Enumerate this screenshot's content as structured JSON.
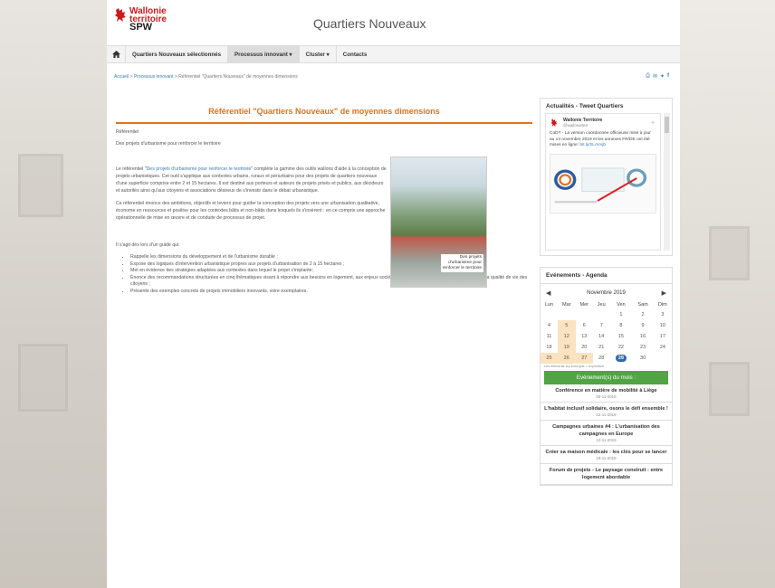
{
  "header": {
    "logo_line1": "Wallonie",
    "logo_line2": "territoire",
    "logo_line3": "SPW",
    "site_title": "Quartiers Nouveaux"
  },
  "nav": {
    "items": [
      {
        "label": "Quartiers Nouveaux sélectionnés"
      },
      {
        "label": "Processus innovant ▾"
      },
      {
        "label": "Cluster ▾"
      },
      {
        "label": "Contacts"
      }
    ]
  },
  "breadcrumb": {
    "home": "Accueil",
    "parent": "Processus innovant",
    "current": "Référentiel \"Quartiers Nouveaux\" de moyennes dimensions"
  },
  "article": {
    "title": "Référentiel \"Quartiers Nouveaux\" de moyennes dimensions",
    "category": "Référentiel",
    "subtitle": "Des projets d'urbanisme pour renforcer le territoire",
    "p1_before": "Le référentiel \"",
    "p1_link": "Des projets d'urbanisme pour renforcer le territoire",
    "p1_after": "\" complète la gamme des outils wallons d'aide à la conception de projets urbanistiques. Cet outil s'applique aux contextes urbains, ruraux et périurbains pour des projets de quartiers nouveaux d'une superficie comprise entre 2 et 15 hectares. Il est destiné aux porteurs et auteurs de projets privés et publics, aux décideurs et autorités ainsi qu'aux citoyens et associations désireux de s'investir dans le débat urbanistique.",
    "p2": "Ce référentiel énonce des ambitions, objectifs et leviers pour guider la conception des projets vers une urbanisation qualitative, économe en ressources et positive pour les contextes bâtis et non-bâtis dans lesquels ils s'insèrent ; en ce compris une approche opérationnelle de mise en œuvre et de conduite de processus de projet.",
    "cover_label_1": "Des projets",
    "cover_label_2": "d'urbanisme pour",
    "cover_label_3": "renforcer le territoire",
    "guide_intro": "Il s'agit dès lors d'un guide qui:",
    "bullets": [
      "Rappelle les dimensions du développement et de l'urbanisme durable ;",
      "Expose des logiques d'intervention urbanistique propres aux projets d'urbanisation de 2 à 15 hectares ;",
      "Met en évidence des stratégies adaptées aux contextes dans lequel le projet s'implante;",
      "Énonce des recommandations structurées en cinq thématiques visant à répondre aux besoins en logement, aux enjeux sociétaux et territoriaux ainsi qu'à l'amélioration de la qualité de vie des citoyens ;",
      "Présente des exemples concrets de projets immobiliers innovants, voire exemplaires."
    ]
  },
  "tweets": {
    "title": "Actualités - Tweet Quartiers",
    "name": "Wallonie Territoire",
    "handle": "@wallonieterr",
    "text": "CoDT - La version coordonnée officieuse mise à jour au 14 novembre 2019 et les annexes FR/DE ont été mises en ligne:",
    "link": "bit.ly/2LAVvjb"
  },
  "agenda": {
    "title": "Evénements - Agenda",
    "month": "Novembre 2019",
    "weekdays": [
      "Lun",
      "Mar",
      "Mer",
      "Jeu",
      "Ven",
      "Sam",
      "Dim"
    ],
    "weeks": [
      [
        "",
        "",
        "",
        "",
        "1",
        "2",
        "3"
      ],
      [
        "4",
        "5",
        "6",
        "7",
        "8",
        "9",
        "10"
      ],
      [
        "11",
        "12",
        "13",
        "14",
        "15",
        "16",
        "17"
      ],
      [
        "18",
        "19",
        "20",
        "21",
        "22",
        "23",
        "24"
      ],
      [
        "25",
        "26",
        "27",
        "28",
        "29",
        "30",
        ""
      ]
    ],
    "note": "Les éléments sur fond gris = exposition",
    "events_header": "Evénement(s) du mois :",
    "events": [
      {
        "name": "Conférence en matière de mobilité à Liège",
        "date": "05-11-2019"
      },
      {
        "name": "L'habitat inclusif solidaire, osons le défi ensemble !",
        "date": "12-11-2019"
      },
      {
        "name": "Campagnes urbaines #4 : L'urbanisation des campagnes en Europe",
        "date": "12-11-2019"
      },
      {
        "name": "Créer sa maison médicale : les clés pour se lancer",
        "date": "19-11-2019"
      },
      {
        "name": "Forum de projets - Le paysage construit : entre logement abordable",
        "date": ""
      }
    ]
  },
  "colors": {
    "accent": "#e0731e",
    "brand_red": "#d0181e",
    "link": "#3a79b8",
    "event_green": "#50a443",
    "today_blue": "#2e6aa8"
  }
}
